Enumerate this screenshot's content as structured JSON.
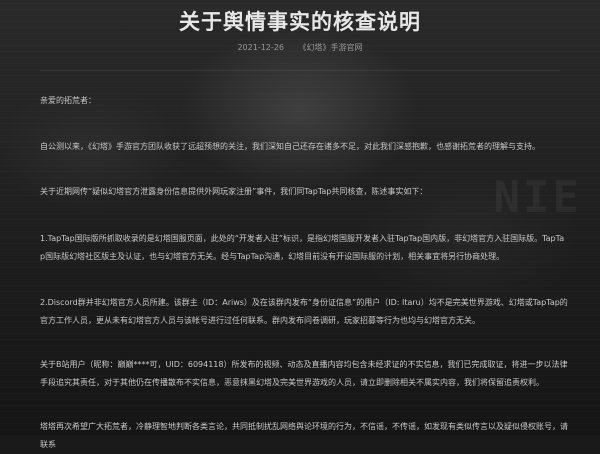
{
  "article": {
    "title": "关于舆情事实的核查说明",
    "date": "2021-12-26",
    "source": "《幻塔》手游官网",
    "paragraphs": [
      "亲爱的拓荒者：",
      "自公测以来，《幻塔》手游官方团队收获了远超预想的关注，我们深知自己还存在诸多不足，对此我们深感抱歉，也感谢拓荒者的理解与支持。",
      "关于近期网传“疑似幻塔官方泄露身份信息提供外网玩家注册”事件，我们同TapTap共同核查，陈述事实如下：",
      "1.TapTap国际版所抓取收录的是幻塔国服页面，此处的“开发者入驻”标识，是指幻塔国服开发者入驻TapTap国内版，非幻塔官方入驻国际版。TapTap国际版幻塔社区版主及认证，也与幻塔官方无关。经与TapTap沟通，幻塔目前没有开设国际服的计划，相关事宜将另行协商处理。",
      "2.Discord群并非幻塔官方人员所建。该群主（ID：Ariws）及在该群内发布“身份证信息”的用户（ID: Itaru）均不是完美世界游戏、幻塔或TapTap的官方工作人员，更从未有幻塔官方人员与该帐号进行过任何联系。群内发布问卷调研，玩家招募等行为也均与幻塔官方无关。",
      "关于B站用户（昵称：巅巅****可，UID：6094118）所发布的视频、动态及直播内容均包含未经求证的不实信息，我们已完成取证，将进一步以法律手段追究其责任，对于其他仍在传播散布不实信息，恶意抹黑幻塔及完美世界游戏的人员，请立即删除相关不属实内容，我们将保留追责权利。",
      "塔塔再次希望广大拓荒者，冷静理智地判断各类言论，共同抵制扰乱网络舆论环境的行为，不信谣，不传谣，如发现有类似传言以及疑似侵权账号，请联系"
    ]
  },
  "decor": {
    "background_text": "NIE"
  }
}
